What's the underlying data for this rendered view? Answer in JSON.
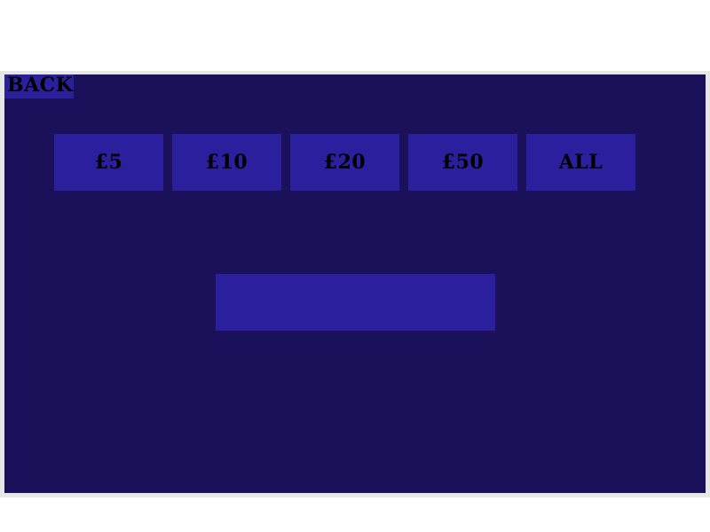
{
  "header": {
    "back_label": "BACK"
  },
  "amounts": {
    "five": "£5",
    "ten": "£10",
    "twenty": "£20",
    "fifty": "£50",
    "all": "ALL"
  },
  "display": {
    "value": ""
  },
  "colors": {
    "panel_background": "#1a115a",
    "button_background": "#2b1f9d",
    "frame_border": "#e6e6e6",
    "text": "#000000"
  }
}
